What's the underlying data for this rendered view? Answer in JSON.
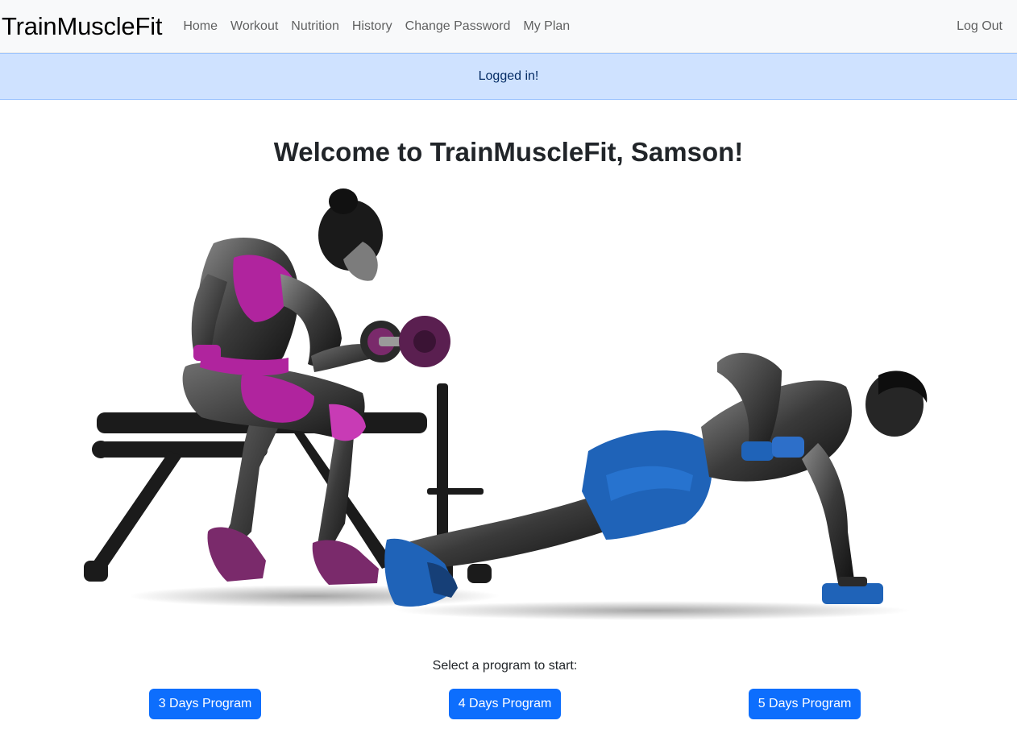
{
  "navbar": {
    "brand": "TrainMuscleFit",
    "links": [
      "Home",
      "Workout",
      "Nutrition",
      "History",
      "Change Password",
      "My Plan"
    ],
    "logout": "Log Out"
  },
  "alert": {
    "message": "Logged in!"
  },
  "main": {
    "welcome": "Welcome to TrainMuscleFit, Samson!",
    "hero_image": "fitness-couple-workout-silhouette",
    "prompt": "Select a program to start:",
    "programs": [
      "3 Days Program",
      "4 Days Program",
      "5 Days Program"
    ]
  },
  "colors": {
    "primary": "#0d6efd",
    "alert_bg": "#cfe2ff",
    "alert_text": "#052c65",
    "navbar_bg": "#f8f9fa",
    "accent_magenta": "#b0249e",
    "accent_blue": "#1f63b8"
  }
}
